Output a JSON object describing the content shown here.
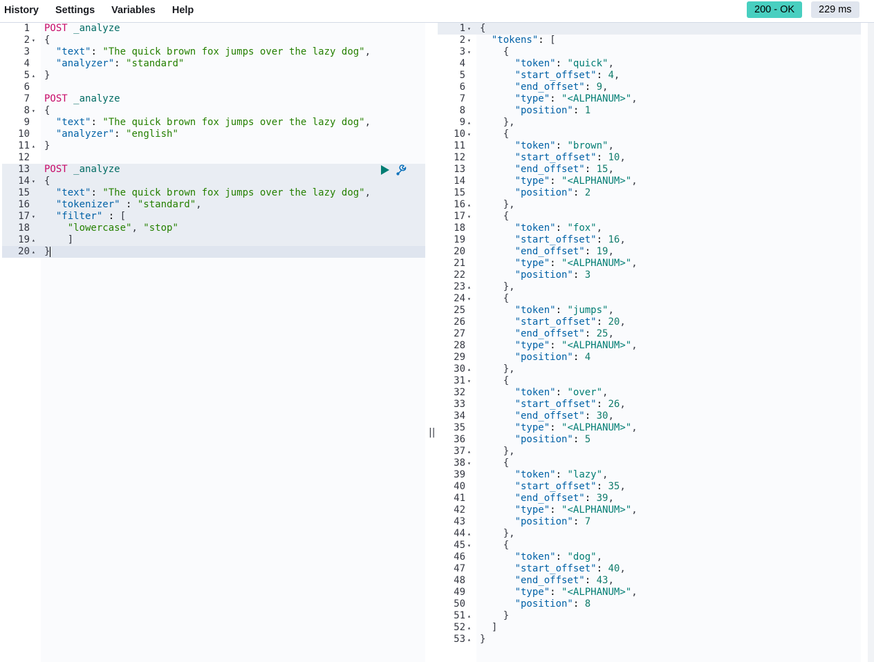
{
  "menu": {
    "history": "History",
    "settings": "Settings",
    "variables": "Variables",
    "help": "Help"
  },
  "status": {
    "code": "200 - OK",
    "time": "229 ms"
  },
  "colors": {
    "status_ok": "#48cfc0",
    "method": "#c80a68",
    "string": "#258000",
    "key": "#0061a6"
  },
  "icons": {
    "play": "play-icon",
    "wrench": "wrench-icon",
    "fold_down": "chevron-down-icon",
    "fold_up": "chevron-up-icon"
  },
  "request_lines": [
    {
      "n": "1",
      "fold": "",
      "code": "POST _analyze"
    },
    {
      "n": "2",
      "fold": "▾",
      "code": "{"
    },
    {
      "n": "3",
      "fold": "",
      "code": "  \"text\": \"The quick brown fox jumps over the lazy dog\","
    },
    {
      "n": "4",
      "fold": "",
      "code": "  \"analyzer\": \"standard\""
    },
    {
      "n": "5",
      "fold": "▴",
      "code": "}"
    },
    {
      "n": "6",
      "fold": "",
      "code": ""
    },
    {
      "n": "7",
      "fold": "",
      "code": "POST _analyze"
    },
    {
      "n": "8",
      "fold": "▾",
      "code": "{"
    },
    {
      "n": "9",
      "fold": "",
      "code": "  \"text\": \"The quick brown fox jumps over the lazy dog\","
    },
    {
      "n": "10",
      "fold": "",
      "code": "  \"analyzer\": \"english\""
    },
    {
      "n": "11",
      "fold": "▴",
      "code": "}"
    },
    {
      "n": "12",
      "fold": "",
      "code": ""
    },
    {
      "n": "13",
      "fold": "",
      "code": "POST _analyze"
    },
    {
      "n": "14",
      "fold": "▾",
      "code": "{"
    },
    {
      "n": "15",
      "fold": "",
      "code": "  \"text\": \"The quick brown fox jumps over the lazy dog\","
    },
    {
      "n": "16",
      "fold": "",
      "code": "  \"tokenizer\" : \"standard\","
    },
    {
      "n": "17",
      "fold": "▾",
      "code": "  \"filter\" : ["
    },
    {
      "n": "18",
      "fold": "",
      "code": "    \"lowercase\", \"stop\""
    },
    {
      "n": "19",
      "fold": "▴",
      "code": "    ]"
    },
    {
      "n": "20",
      "fold": "▴",
      "code": "}"
    }
  ],
  "response_lines": [
    {
      "n": "1",
      "fold": "▾",
      "code": "{"
    },
    {
      "n": "2",
      "fold": "▾",
      "code": "  \"tokens\": ["
    },
    {
      "n": "3",
      "fold": "▾",
      "code": "    {"
    },
    {
      "n": "4",
      "fold": "",
      "code": "      \"token\": \"quick\","
    },
    {
      "n": "5",
      "fold": "",
      "code": "      \"start_offset\": 4,"
    },
    {
      "n": "6",
      "fold": "",
      "code": "      \"end_offset\": 9,"
    },
    {
      "n": "7",
      "fold": "",
      "code": "      \"type\": \"<ALPHANUM>\","
    },
    {
      "n": "8",
      "fold": "",
      "code": "      \"position\": 1"
    },
    {
      "n": "9",
      "fold": "▴",
      "code": "    },"
    },
    {
      "n": "10",
      "fold": "▾",
      "code": "    {"
    },
    {
      "n": "11",
      "fold": "",
      "code": "      \"token\": \"brown\","
    },
    {
      "n": "12",
      "fold": "",
      "code": "      \"start_offset\": 10,"
    },
    {
      "n": "13",
      "fold": "",
      "code": "      \"end_offset\": 15,"
    },
    {
      "n": "14",
      "fold": "",
      "code": "      \"type\": \"<ALPHANUM>\","
    },
    {
      "n": "15",
      "fold": "",
      "code": "      \"position\": 2"
    },
    {
      "n": "16",
      "fold": "▴",
      "code": "    },"
    },
    {
      "n": "17",
      "fold": "▾",
      "code": "    {"
    },
    {
      "n": "18",
      "fold": "",
      "code": "      \"token\": \"fox\","
    },
    {
      "n": "19",
      "fold": "",
      "code": "      \"start_offset\": 16,"
    },
    {
      "n": "20",
      "fold": "",
      "code": "      \"end_offset\": 19,"
    },
    {
      "n": "21",
      "fold": "",
      "code": "      \"type\": \"<ALPHANUM>\","
    },
    {
      "n": "22",
      "fold": "",
      "code": "      \"position\": 3"
    },
    {
      "n": "23",
      "fold": "▴",
      "code": "    },"
    },
    {
      "n": "24",
      "fold": "▾",
      "code": "    {"
    },
    {
      "n": "25",
      "fold": "",
      "code": "      \"token\": \"jumps\","
    },
    {
      "n": "26",
      "fold": "",
      "code": "      \"start_offset\": 20,"
    },
    {
      "n": "27",
      "fold": "",
      "code": "      \"end_offset\": 25,"
    },
    {
      "n": "28",
      "fold": "",
      "code": "      \"type\": \"<ALPHANUM>\","
    },
    {
      "n": "29",
      "fold": "",
      "code": "      \"position\": 4"
    },
    {
      "n": "30",
      "fold": "▴",
      "code": "    },"
    },
    {
      "n": "31",
      "fold": "▾",
      "code": "    {"
    },
    {
      "n": "32",
      "fold": "",
      "code": "      \"token\": \"over\","
    },
    {
      "n": "33",
      "fold": "",
      "code": "      \"start_offset\": 26,"
    },
    {
      "n": "34",
      "fold": "",
      "code": "      \"end_offset\": 30,"
    },
    {
      "n": "35",
      "fold": "",
      "code": "      \"type\": \"<ALPHANUM>\","
    },
    {
      "n": "36",
      "fold": "",
      "code": "      \"position\": 5"
    },
    {
      "n": "37",
      "fold": "▴",
      "code": "    },"
    },
    {
      "n": "38",
      "fold": "▾",
      "code": "    {"
    },
    {
      "n": "39",
      "fold": "",
      "code": "      \"token\": \"lazy\","
    },
    {
      "n": "40",
      "fold": "",
      "code": "      \"start_offset\": 35,"
    },
    {
      "n": "41",
      "fold": "",
      "code": "      \"end_offset\": 39,"
    },
    {
      "n": "42",
      "fold": "",
      "code": "      \"type\": \"<ALPHANUM>\","
    },
    {
      "n": "43",
      "fold": "",
      "code": "      \"position\": 7"
    },
    {
      "n": "44",
      "fold": "▴",
      "code": "    },"
    },
    {
      "n": "45",
      "fold": "▾",
      "code": "    {"
    },
    {
      "n": "46",
      "fold": "",
      "code": "      \"token\": \"dog\","
    },
    {
      "n": "47",
      "fold": "",
      "code": "      \"start_offset\": 40,"
    },
    {
      "n": "48",
      "fold": "",
      "code": "      \"end_offset\": 43,"
    },
    {
      "n": "49",
      "fold": "",
      "code": "      \"type\": \"<ALPHANUM>\","
    },
    {
      "n": "50",
      "fold": "",
      "code": "      \"position\": 8"
    },
    {
      "n": "51",
      "fold": "▴",
      "code": "    }"
    },
    {
      "n": "52",
      "fold": "▴",
      "code": "  ]"
    },
    {
      "n": "53",
      "fold": "▴",
      "code": "}"
    }
  ],
  "divider_handle": "||"
}
